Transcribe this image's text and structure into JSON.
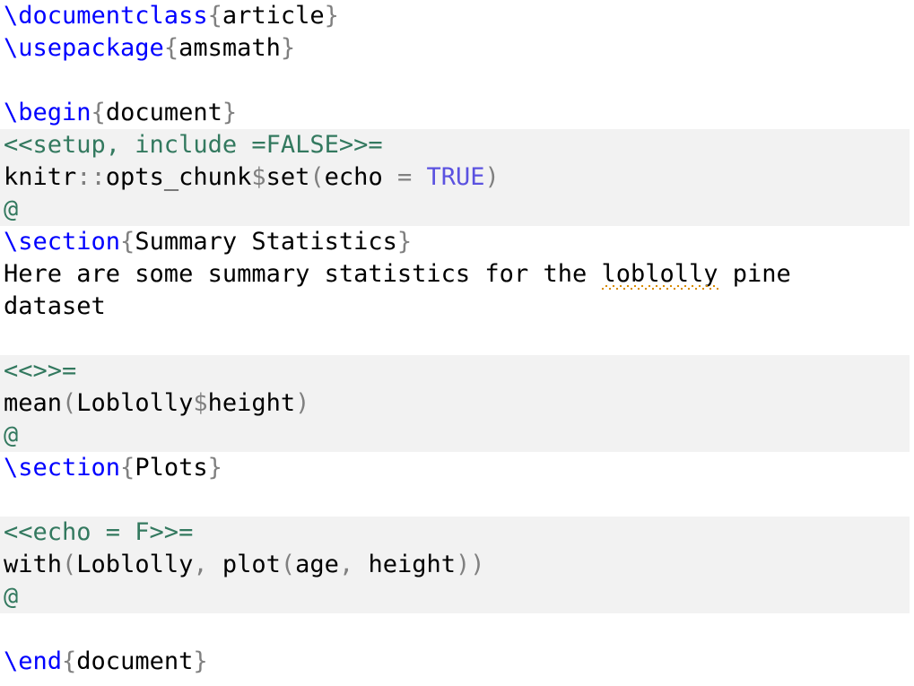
{
  "editor": {
    "language": "Sweave (Rnw)",
    "background": "#ffffff",
    "chunk_background": "#f2f2f2",
    "colors": {
      "latex_command": "#0000ff",
      "brace": "#808080",
      "chunk_delimiter": "#33795f",
      "boolean": "#5b52e0",
      "text": "#000000",
      "spellcheck_underline": "#d98c00"
    }
  },
  "lines": [
    {
      "n": 1,
      "type": "latex",
      "tokens": [
        {
          "t": "cmd",
          "v": "\\documentclass"
        },
        {
          "t": "brace",
          "v": "{"
        },
        {
          "t": "plain",
          "v": "article"
        },
        {
          "t": "brace",
          "v": "}"
        }
      ]
    },
    {
      "n": 2,
      "type": "latex",
      "tokens": [
        {
          "t": "cmd",
          "v": "\\usepackage"
        },
        {
          "t": "brace",
          "v": "{"
        },
        {
          "t": "plain",
          "v": "amsmath"
        },
        {
          "t": "brace",
          "v": "}"
        }
      ]
    },
    {
      "n": 3,
      "type": "blank",
      "tokens": []
    },
    {
      "n": 4,
      "type": "latex",
      "tokens": [
        {
          "t": "cmd",
          "v": "\\begin"
        },
        {
          "t": "brace",
          "v": "{"
        },
        {
          "t": "plain",
          "v": "document"
        },
        {
          "t": "brace",
          "v": "}"
        }
      ]
    },
    {
      "n": 5,
      "type": "chunk",
      "tokens": [
        {
          "t": "chunktag",
          "v": "<<setup, include =FALSE>>="
        }
      ]
    },
    {
      "n": 6,
      "type": "chunk",
      "tokens": [
        {
          "t": "plain",
          "v": "knitr"
        },
        {
          "t": "paren",
          "v": "::"
        },
        {
          "t": "plain",
          "v": "opts_chunk"
        },
        {
          "t": "dollar",
          "v": "$"
        },
        {
          "t": "plain",
          "v": "set"
        },
        {
          "t": "paren",
          "v": "("
        },
        {
          "t": "plain",
          "v": "echo "
        },
        {
          "t": "paren",
          "v": "="
        },
        {
          "t": "plain",
          "v": " "
        },
        {
          "t": "bool",
          "v": "TRUE"
        },
        {
          "t": "paren",
          "v": ")"
        }
      ]
    },
    {
      "n": 7,
      "type": "chunk",
      "tokens": [
        {
          "t": "chunktag",
          "v": "@"
        }
      ]
    },
    {
      "n": 8,
      "type": "latex",
      "tokens": [
        {
          "t": "cmd",
          "v": "\\section"
        },
        {
          "t": "brace",
          "v": "{"
        },
        {
          "t": "plain",
          "v": "Summary Statistics"
        },
        {
          "t": "brace",
          "v": "}"
        }
      ]
    },
    {
      "n": 9,
      "type": "text",
      "tokens": [
        {
          "t": "plain",
          "v": "Here are some summary statistics for the "
        },
        {
          "t": "misspelled",
          "v": "loblolly"
        },
        {
          "t": "plain",
          "v": " pine"
        }
      ]
    },
    {
      "n": 10,
      "type": "text",
      "tokens": [
        {
          "t": "plain",
          "v": "dataset"
        }
      ]
    },
    {
      "n": 11,
      "type": "blank",
      "tokens": []
    },
    {
      "n": 12,
      "type": "chunk",
      "tokens": [
        {
          "t": "chunktag",
          "v": "<<>>="
        }
      ]
    },
    {
      "n": 13,
      "type": "chunk",
      "tokens": [
        {
          "t": "plain",
          "v": "mean"
        },
        {
          "t": "paren",
          "v": "("
        },
        {
          "t": "plain",
          "v": "Loblolly"
        },
        {
          "t": "dollar",
          "v": "$"
        },
        {
          "t": "plain",
          "v": "height"
        },
        {
          "t": "paren",
          "v": ")"
        }
      ]
    },
    {
      "n": 14,
      "type": "chunk",
      "tokens": [
        {
          "t": "chunktag",
          "v": "@"
        }
      ]
    },
    {
      "n": 15,
      "type": "latex",
      "tokens": [
        {
          "t": "cmd",
          "v": "\\section"
        },
        {
          "t": "brace",
          "v": "{"
        },
        {
          "t": "plain",
          "v": "Plots"
        },
        {
          "t": "brace",
          "v": "}"
        }
      ]
    },
    {
      "n": 16,
      "type": "blank",
      "tokens": []
    },
    {
      "n": 17,
      "type": "chunk",
      "tokens": [
        {
          "t": "chunktag",
          "v": "<<echo = F>>="
        }
      ]
    },
    {
      "n": 18,
      "type": "chunk",
      "tokens": [
        {
          "t": "plain",
          "v": "with"
        },
        {
          "t": "paren",
          "v": "("
        },
        {
          "t": "plain",
          "v": "Loblolly"
        },
        {
          "t": "paren",
          "v": ","
        },
        {
          "t": "plain",
          "v": " plot"
        },
        {
          "t": "paren",
          "v": "("
        },
        {
          "t": "plain",
          "v": "age"
        },
        {
          "t": "paren",
          "v": ","
        },
        {
          "t": "plain",
          "v": " height"
        },
        {
          "t": "paren",
          "v": "))"
        }
      ]
    },
    {
      "n": 19,
      "type": "chunk",
      "tokens": [
        {
          "t": "chunktag",
          "v": "@"
        }
      ]
    },
    {
      "n": 20,
      "type": "blank",
      "tokens": []
    },
    {
      "n": 21,
      "type": "latex",
      "tokens": [
        {
          "t": "cmd",
          "v": "\\end"
        },
        {
          "t": "brace",
          "v": "{"
        },
        {
          "t": "plain",
          "v": "document"
        },
        {
          "t": "brace",
          "v": "}"
        }
      ]
    }
  ]
}
